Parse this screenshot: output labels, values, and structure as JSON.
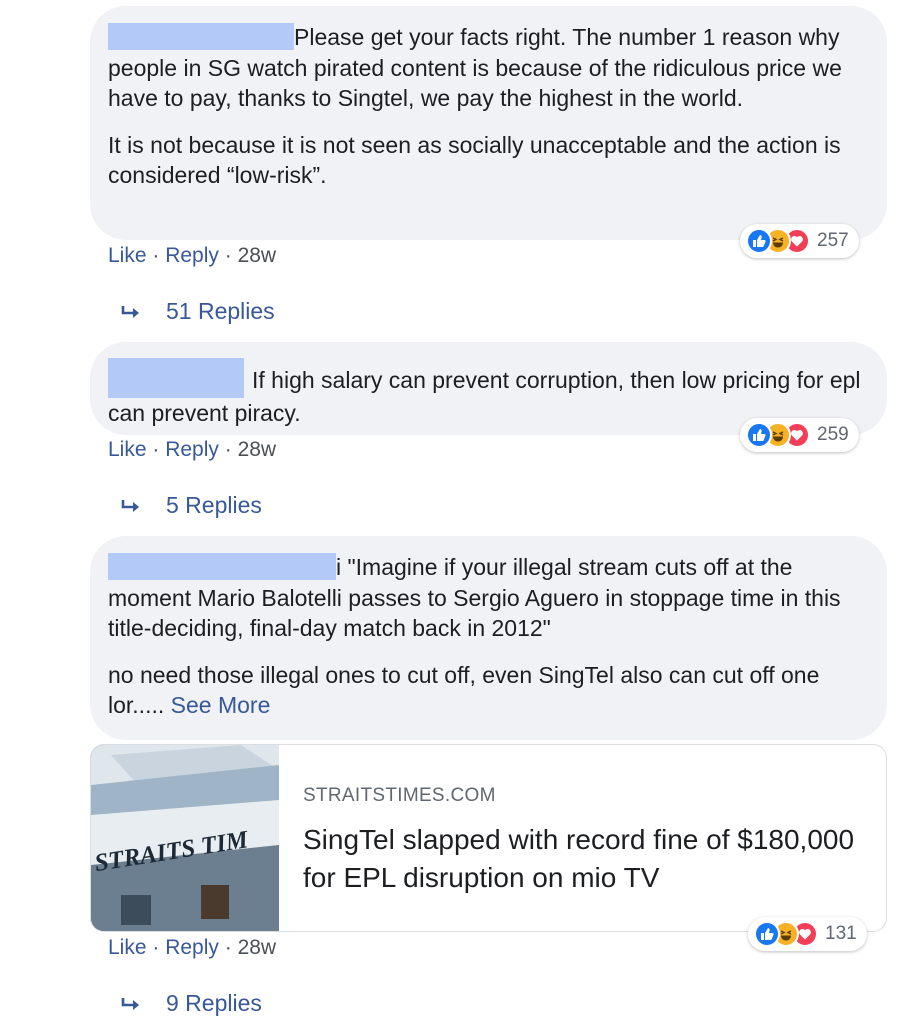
{
  "comments": [
    {
      "paragraphs": [
        "Please get your facts right. The number 1 reason why people in SG watch pirated content is because of the ridiculous price we have to pay, thanks to Singtel, we pay the highest in the world.",
        "It is not because it is not seen as socially unacceptable and the action is considered “low-risk”."
      ],
      "actions": {
        "like": "Like",
        "sep1": " · ",
        "reply": "Reply",
        "sep2": " · ",
        "time": "28w"
      },
      "reaction_count": "257",
      "replies_label": "51 Replies"
    },
    {
      "paragraphs": [
        "If high salary can prevent corruption, then low pricing for epl can prevent piracy."
      ],
      "actions": {
        "like": "Like",
        "sep1": " · ",
        "reply": "Reply",
        "sep2": " · ",
        "time": "28w"
      },
      "reaction_count": "259",
      "replies_label": "5 Replies"
    },
    {
      "paragraphs": [
        "i \"Imagine if your illegal stream cuts off at the moment Mario Balotelli passes to Sergio Aguero in stoppage time in this title-deciding, final-day match back in 2012\"",
        "no need those illegal ones to cut off, even SingTel also can cut off one lor....."
      ],
      "see_more": "See More",
      "link_preview": {
        "domain": "STRAITSTIMES.COM",
        "title": "SingTel slapped with record fine of $180,000 for EPL disruption on mio TV",
        "thumbnail_text": "STRAITS TIM"
      },
      "actions": {
        "like": "Like",
        "sep1": " · ",
        "reply": "Reply",
        "sep2": " · ",
        "time": "28w"
      },
      "reaction_count": "131",
      "replies_label": "9 Replies"
    }
  ],
  "reaction_icons": [
    "like-icon",
    "haha-icon",
    "love-icon"
  ],
  "colors": {
    "bubble_bg": "#f0f2f5",
    "link_blue": "#385898",
    "redaction": "#b3c9f7",
    "like_blue": "#1877f2",
    "haha_yellow": "#f7b125",
    "love_red": "#f33e58"
  }
}
